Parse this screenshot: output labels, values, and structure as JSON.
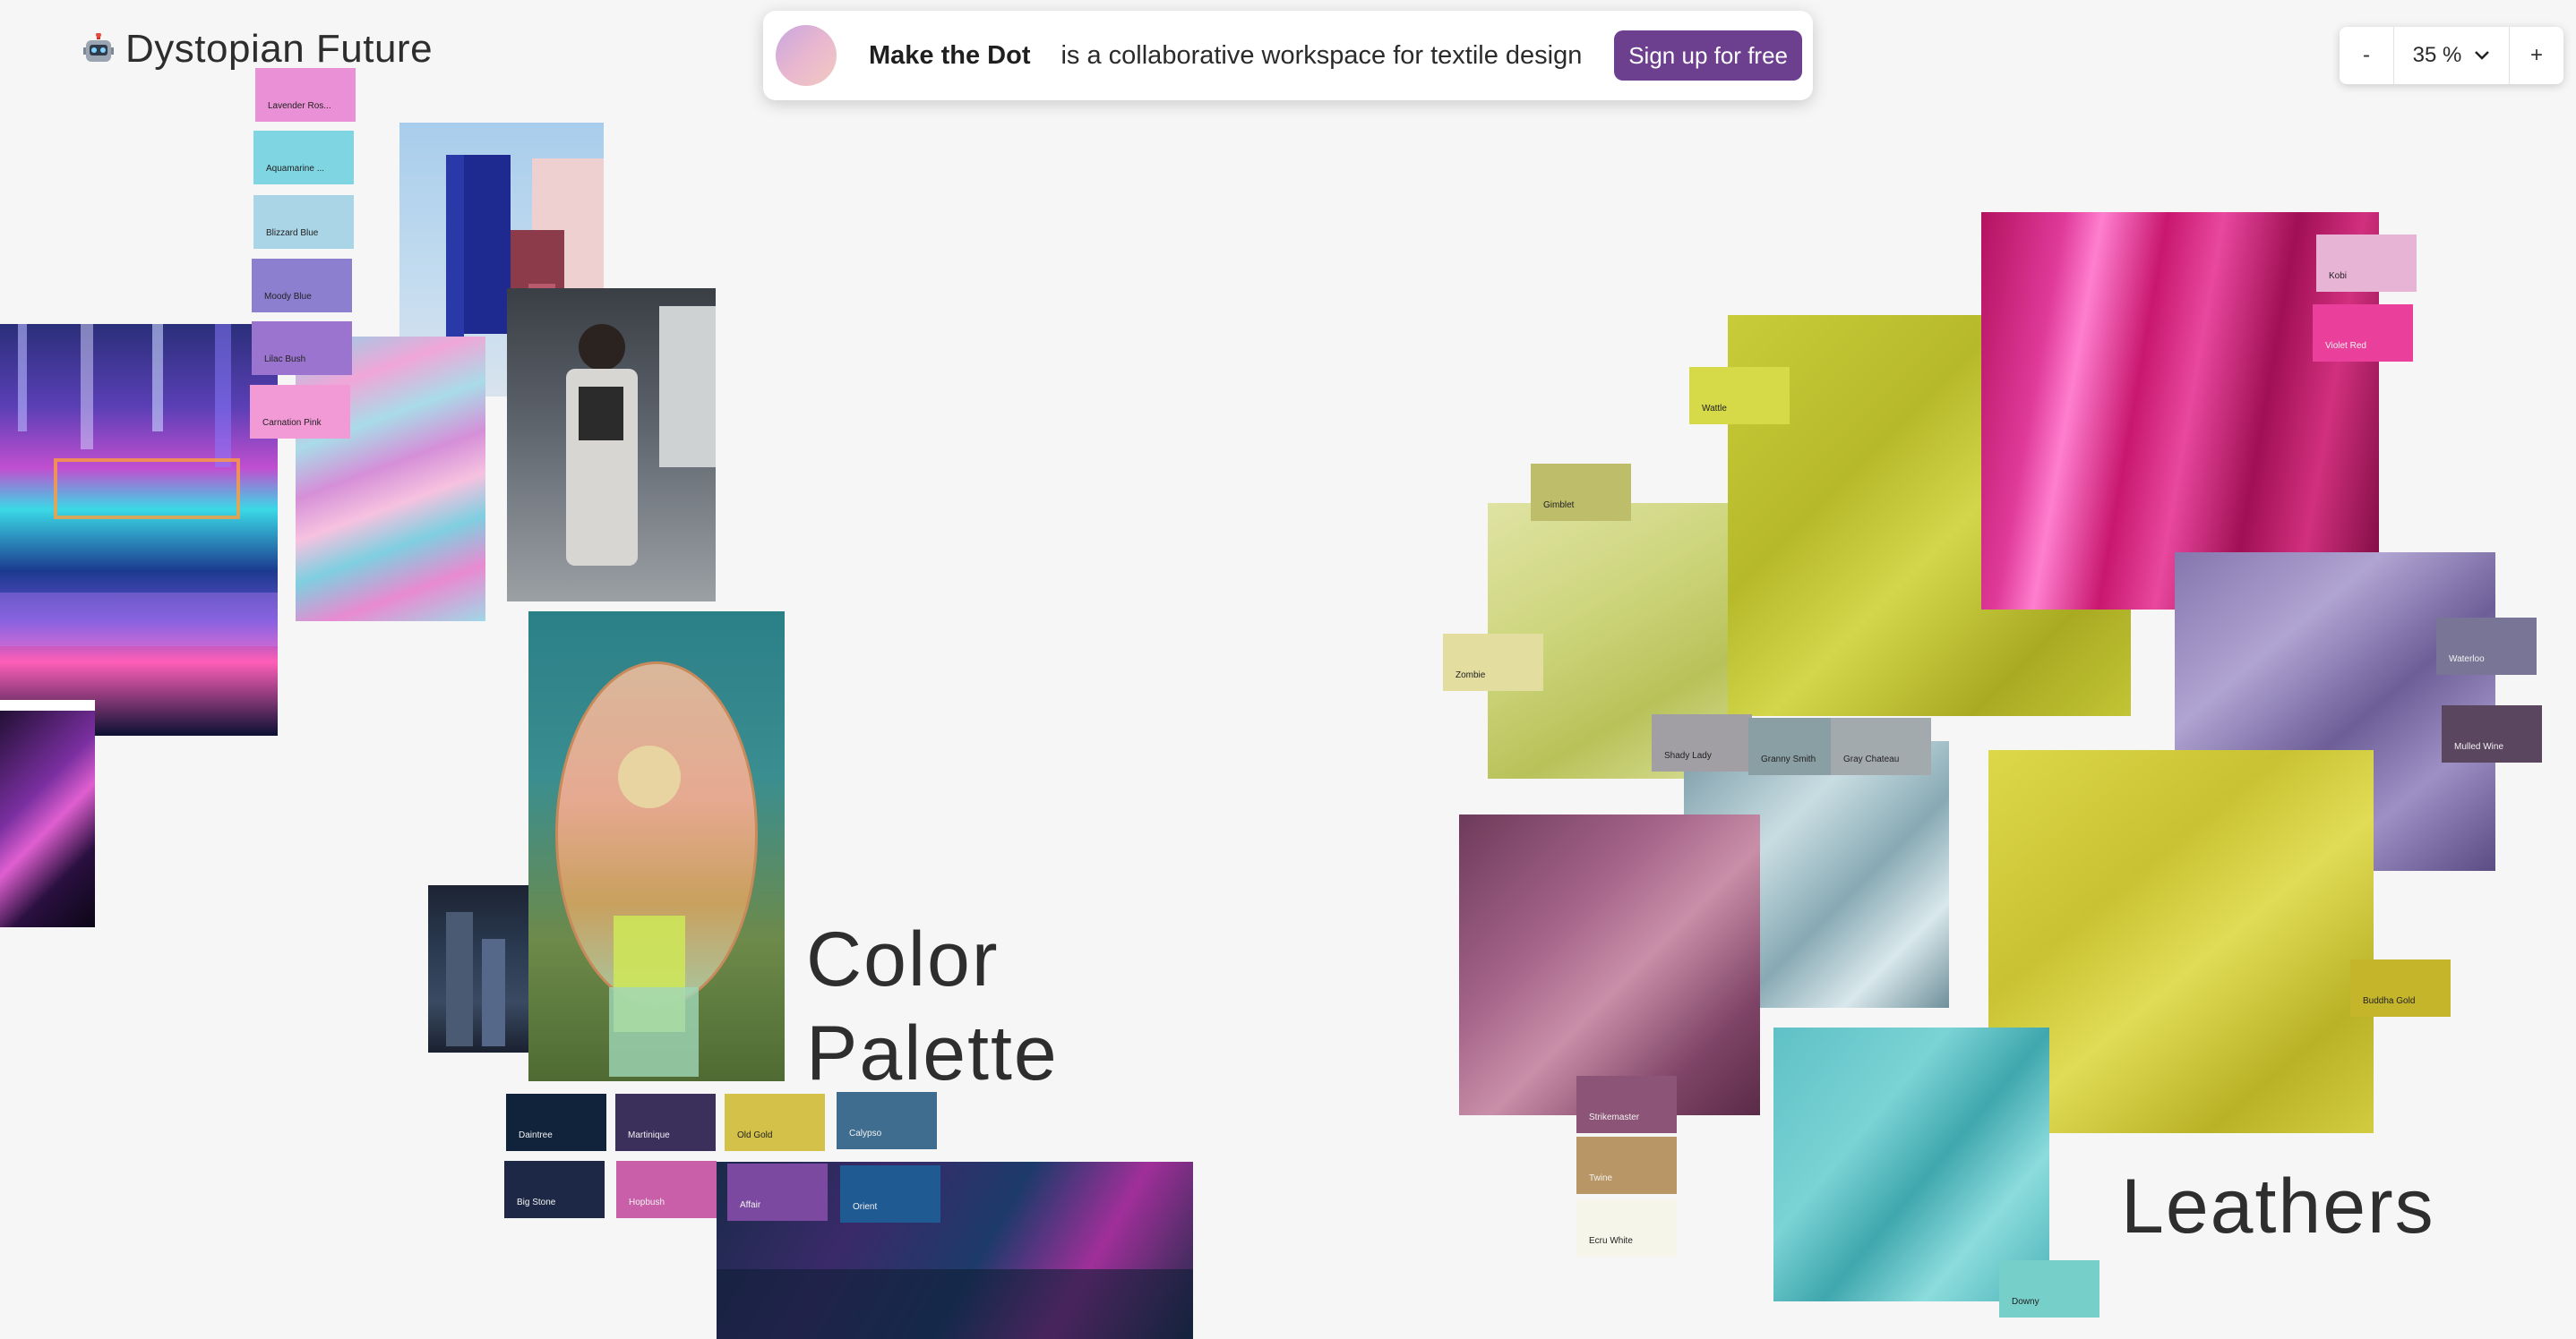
{
  "board": {
    "title": "Dystopian Future",
    "icon": "robot-icon"
  },
  "promo": {
    "brand": "Make the Dot",
    "tagline": "is a collaborative workspace for textile design",
    "signup_label": "Sign up for free",
    "accent": "#6d3f8f"
  },
  "zoom": {
    "minus": "-",
    "plus": "+",
    "value": "35 %"
  },
  "sections": {
    "color_palette": "Color\nPalette",
    "leathers": "Leathers"
  },
  "swatches": {
    "lavender_rose": "Lavender Ros...",
    "aquamarine": "Aquamarine ...",
    "blizzard_blue": "Blizzard Blue",
    "moody_blue": "Moody Blue",
    "lilac_bush": "Lilac Bush",
    "carnation_pink": "Carnation Pink",
    "daintree": "Daintree",
    "martinique": "Martinique",
    "old_gold": "Old Gold",
    "calypso": "Calypso",
    "big_stone": "Big Stone",
    "hopbush": "Hopbush",
    "affair": "Affair",
    "orient": "Orient",
    "wattle": "Wattle",
    "gimblet": "Gimblet",
    "zombie": "Zombie",
    "shady_lady": "Shady Lady",
    "granny_smith": "Granny Smith",
    "gray_chateau": "Gray Chateau",
    "kobi": "Kobi",
    "violet_red": "Violet Red",
    "waterloo": "Waterloo",
    "mulled_wine": "Mulled Wine",
    "buddha_gold": "Buddha Gold",
    "strikemaster": "Strikemaster",
    "twine": "Twine",
    "ecru_white": "Ecru White",
    "downy": "Downy"
  }
}
